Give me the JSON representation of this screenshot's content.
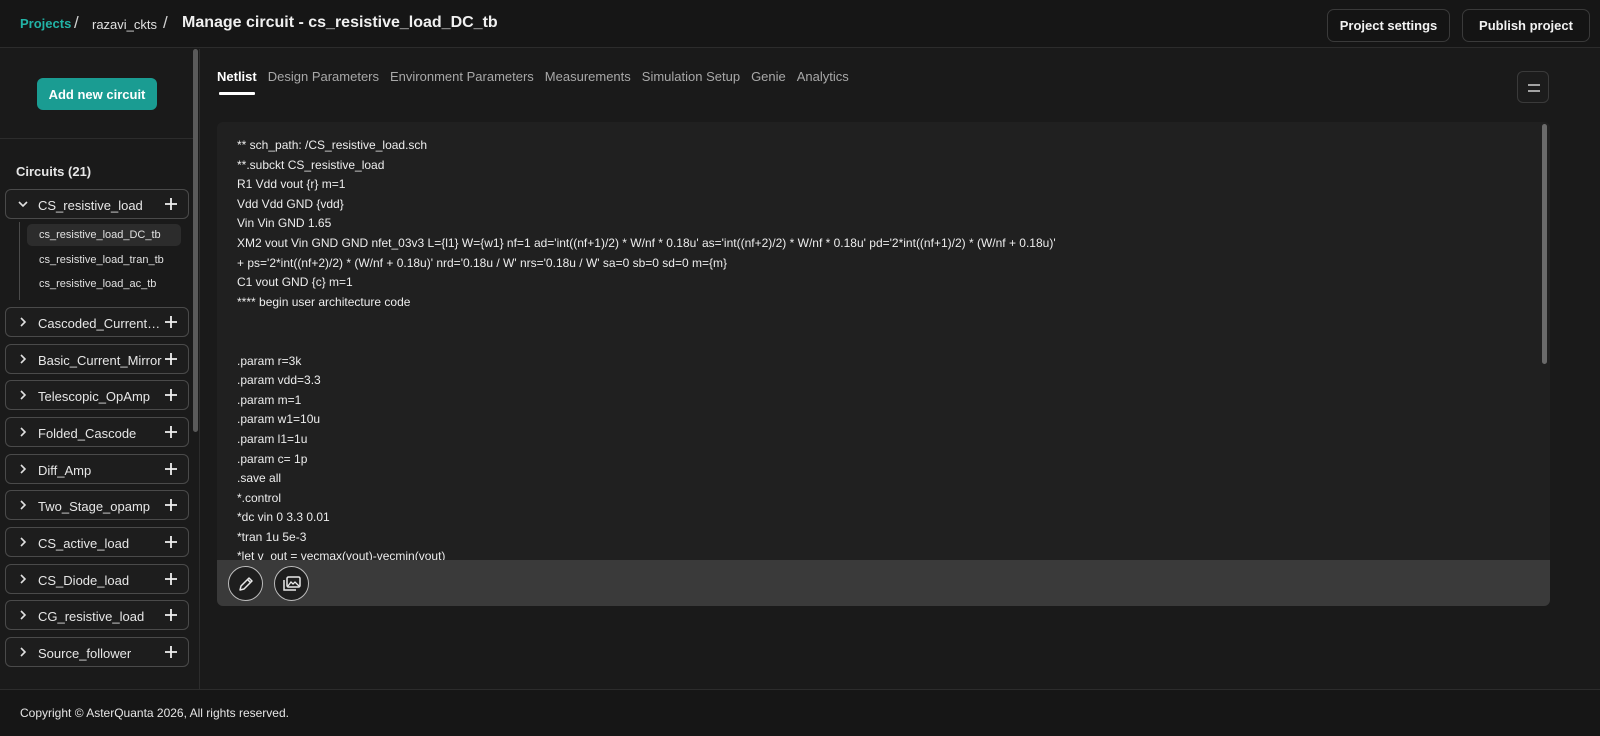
{
  "header": {
    "breadcrumb_projects": "Projects",
    "separator": "/",
    "project_name": "razavi_ckts",
    "page_title": "Manage circuit - cs_resistive_load_DC_tb",
    "project_settings_label": "Project settings",
    "publish_label": "Publish project"
  },
  "sidebar": {
    "add_circuit_label": "Add new circuit",
    "circuits_title": "Circuits (21)",
    "circuits": [
      {
        "label": "CS_resistive_load",
        "expanded": true
      },
      {
        "label": "Cascoded_Current_M...",
        "expanded": false
      },
      {
        "label": "Basic_Current_Mirror",
        "expanded": false
      },
      {
        "label": "Telescopic_OpAmp",
        "expanded": false
      },
      {
        "label": "Folded_Cascode",
        "expanded": false
      },
      {
        "label": "Diff_Amp",
        "expanded": false
      },
      {
        "label": "Two_Stage_opamp",
        "expanded": false
      },
      {
        "label": "CS_active_load",
        "expanded": false
      },
      {
        "label": "CS_Diode_load",
        "expanded": false
      },
      {
        "label": "CG_resistive_load",
        "expanded": false
      },
      {
        "label": "Source_follower",
        "expanded": false
      }
    ],
    "testbenches": [
      {
        "label": "cs_resistive_load_DC_tb",
        "active": true
      },
      {
        "label": "cs_resistive_load_tran_tb",
        "active": false
      },
      {
        "label": "cs_resistive_load_ac_tb",
        "active": false
      }
    ]
  },
  "tabs": [
    {
      "label": "Netlist",
      "active": true
    },
    {
      "label": "Design Parameters",
      "active": false
    },
    {
      "label": "Environment Parameters",
      "active": false
    },
    {
      "label": "Measurements",
      "active": false
    },
    {
      "label": "Simulation Setup",
      "active": false
    },
    {
      "label": "Genie",
      "active": false
    },
    {
      "label": "Analytics",
      "active": false
    }
  ],
  "netlist_lines": [
    "** sch_path: /CS_resistive_load.sch",
    "**.subckt CS_resistive_load",
    "R1 Vdd vout {r} m=1",
    "Vdd Vdd GND {vdd}",
    "Vin Vin GND 1.65",
    "XM2 vout Vin GND GND nfet_03v3 L={l1} W={w1} nf=1 ad='int((nf+1)/2) * W/nf * 0.18u' as='int((nf+2)/2) * W/nf * 0.18u' pd='2*int((nf+1)/2) * (W/nf + 0.18u)'",
    "+ ps='2*int((nf+2)/2) * (W/nf + 0.18u)' nrd='0.18u / W' nrs='0.18u / W' sa=0 sb=0 sd=0 m={m}",
    "C1 vout GND {c} m=1",
    "**** begin user architecture code",
    "",
    "",
    ".param r=3k",
    ".param vdd=3.3",
    ".param m=1",
    ".param w1=10u",
    ".param l1=1u",
    ".param c= 1p",
    ".save all",
    "*.control",
    "*dc vin 0 3.3 0.01",
    "*tran 1u 5e-3",
    "*let v_out = vecmax(vout)-vecmin(vout)"
  ],
  "footer": {
    "copyright": "Copyright © AsterQuanta 2026, All rights reserved."
  },
  "colors": {
    "accent": "#1a9c92",
    "link": "#22b3a6",
    "background": "#1a1a1a",
    "editor_bg": "#202020"
  },
  "icons": {
    "collapse": "chevron-down-icon",
    "expand": "chevron-right-icon",
    "add": "plus-icon",
    "menu": "menu-icon",
    "edit": "pencil-icon",
    "image": "images-icon"
  }
}
